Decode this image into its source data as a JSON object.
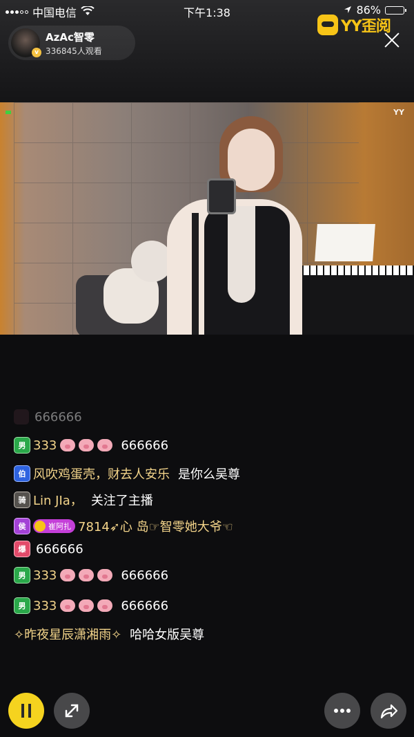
{
  "status_bar": {
    "carrier": "中国电信",
    "time": "下午1:38",
    "battery_percent": "86%",
    "battery_level": 0.86
  },
  "anchor": {
    "name": "AzAc智零",
    "viewers": "336845人观看",
    "verified_badge": "v"
  },
  "app_logo": {
    "text": "YY歪阅"
  },
  "video": {
    "watermark": "YY"
  },
  "chat": [
    {
      "badge": "",
      "badge_color": "dim",
      "user": "",
      "content": "666666",
      "faded": true
    },
    {
      "badge": "男",
      "badge_color": "green",
      "user": "333",
      "pigs": 3,
      "content": "666666"
    },
    {
      "badge": "伯",
      "badge_color": "blue",
      "user": "风吹鸡蛋壳，财去人安乐",
      "content": "是你么吴尊"
    },
    {
      "badge": "骑",
      "badge_color": "gray",
      "user": "Lin JIa，",
      "content": "关注了主播"
    },
    {
      "badge": "侯",
      "badge_color": "purple",
      "gift_tag": "崔阿扎",
      "user": "7814➶心 岛☞智零她大爷☜",
      "content": ""
    },
    {
      "badge": "爆",
      "badge_color": "red",
      "user": "",
      "content": "666666"
    },
    {
      "badge": "男",
      "badge_color": "green",
      "user": "333",
      "pigs": 3,
      "content": "666666"
    },
    {
      "badge": "男",
      "badge_color": "green",
      "user": "333",
      "pigs": 3,
      "content": "666666"
    },
    {
      "badge": "",
      "badge_color": "",
      "user": "✧昨夜星辰潇湘雨✧",
      "content": "哈哈女版吴尊"
    }
  ],
  "controls": {
    "pause_icon": "pause-icon",
    "expand_icon": "expand-icon",
    "more_icon": "more-icon",
    "share_icon": "share-icon"
  },
  "colors": {
    "accent": "#f5d31f",
    "username": "#f3d48a",
    "background": "#0d0d0f"
  }
}
